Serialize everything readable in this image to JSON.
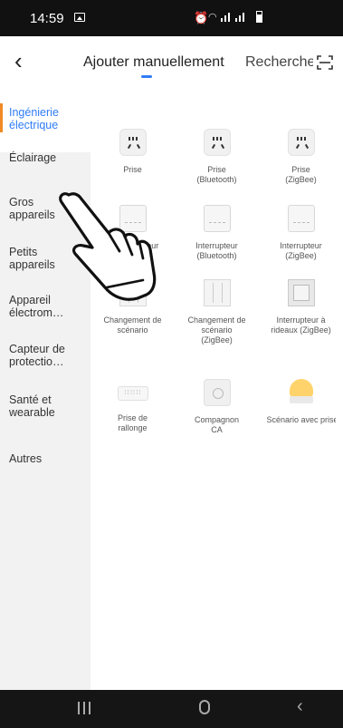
{
  "status_bar": {
    "time": "14:59"
  },
  "header": {
    "back_icon": "back-arrow-icon",
    "tab_add": "Ajouter manuellement",
    "tab_search": "Rechercher",
    "scan_icon": "scan-icon",
    "accent_color": "#2f7cf6"
  },
  "sidebar": {
    "items": [
      {
        "label": "Ingénierie électrique",
        "active": true
      },
      {
        "label": "Éclairage"
      },
      {
        "label": "Gros appareils"
      },
      {
        "label": "Petits appareils"
      },
      {
        "label": "Appareil électrom…"
      },
      {
        "label": "Capteur de protectio…"
      },
      {
        "label": "Santé et wearable"
      },
      {
        "label": "Autres"
      }
    ],
    "active_indicator_color": "#f08a24"
  },
  "devices": [
    {
      "label": "Prise",
      "icon": "plug-icon"
    },
    {
      "label": "Prise (Bluetooth)",
      "icon": "plug-icon"
    },
    {
      "label": "Prise (ZigBee)",
      "icon": "plug-icon"
    },
    {
      "label": "…pteur",
      "icon": "switch-icon"
    },
    {
      "label": "Interrupteur (Bluetooth)",
      "icon": "switch-icon"
    },
    {
      "label": "Interrupteur (ZigBee)",
      "icon": "switch-icon"
    },
    {
      "label": "Changement de scénario",
      "icon": "scene-switch-icon"
    },
    {
      "label": "Changement de scénario (ZigBee)",
      "icon": "scene-switch-icon"
    },
    {
      "label": "Interrupteur à rideaux (ZigBee)",
      "icon": "curtain-switch-icon"
    },
    {
      "label": "Prise de rallonge",
      "icon": "power-strip-icon"
    },
    {
      "label": "Compagnon CA",
      "icon": "ac-companion-icon"
    },
    {
      "label": "Scénario avec prise de …",
      "icon": "lamp-icon"
    }
  ],
  "navbar": {
    "recents_icon": "recents-icon",
    "home_icon": "home-icon",
    "back_icon": "nav-back-icon"
  }
}
